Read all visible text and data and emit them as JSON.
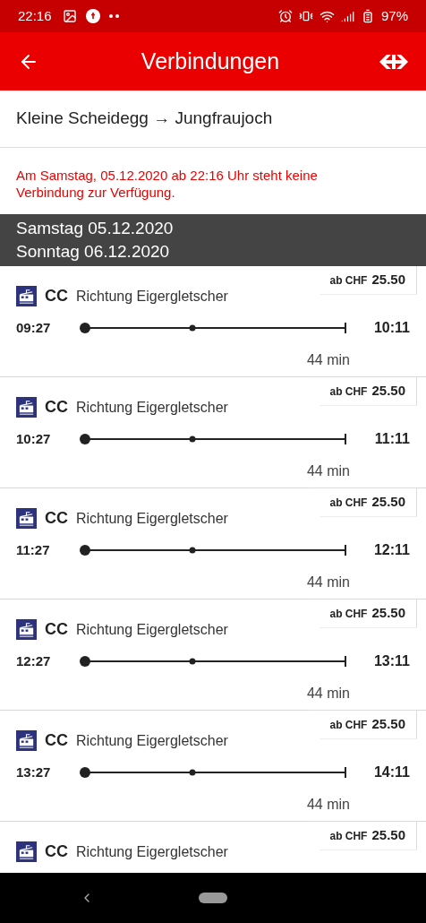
{
  "status_bar": {
    "time": "22:16",
    "battery": "97%"
  },
  "header": {
    "title": "Verbindungen"
  },
  "route": "Kleine Scheidegg → Jungfraujoch",
  "notice": "Am Samstag, 05.12.2020 ab 22:16 Uhr steht keine Verbindung zur Verfügung.",
  "date_headers": [
    {
      "label": "Samstag 05.12.2020"
    },
    {
      "label": "Sonntag 06.12.2020"
    }
  ],
  "connections": [
    {
      "train": "CC",
      "direction": "Richtung Eigergletscher",
      "price_prefix": "ab CHF",
      "price": "25.50",
      "departure": "09:27",
      "arrival": "10:11",
      "duration": "44 min"
    },
    {
      "train": "CC",
      "direction": "Richtung Eigergletscher",
      "price_prefix": "ab CHF",
      "price": "25.50",
      "departure": "10:27",
      "arrival": "11:11",
      "duration": "44 min"
    },
    {
      "train": "CC",
      "direction": "Richtung Eigergletscher",
      "price_prefix": "ab CHF",
      "price": "25.50",
      "departure": "11:27",
      "arrival": "12:11",
      "duration": "44 min"
    },
    {
      "train": "CC",
      "direction": "Richtung Eigergletscher",
      "price_prefix": "ab CHF",
      "price": "25.50",
      "departure": "12:27",
      "arrival": "13:11",
      "duration": "44 min"
    },
    {
      "train": "CC",
      "direction": "Richtung Eigergletscher",
      "price_prefix": "ab CHF",
      "price": "25.50",
      "departure": "13:27",
      "arrival": "14:11",
      "duration": "44 min"
    },
    {
      "train": "CC",
      "direction": "Richtung Eigergletscher",
      "price_prefix": "ab CHF",
      "price": "25.50"
    }
  ]
}
